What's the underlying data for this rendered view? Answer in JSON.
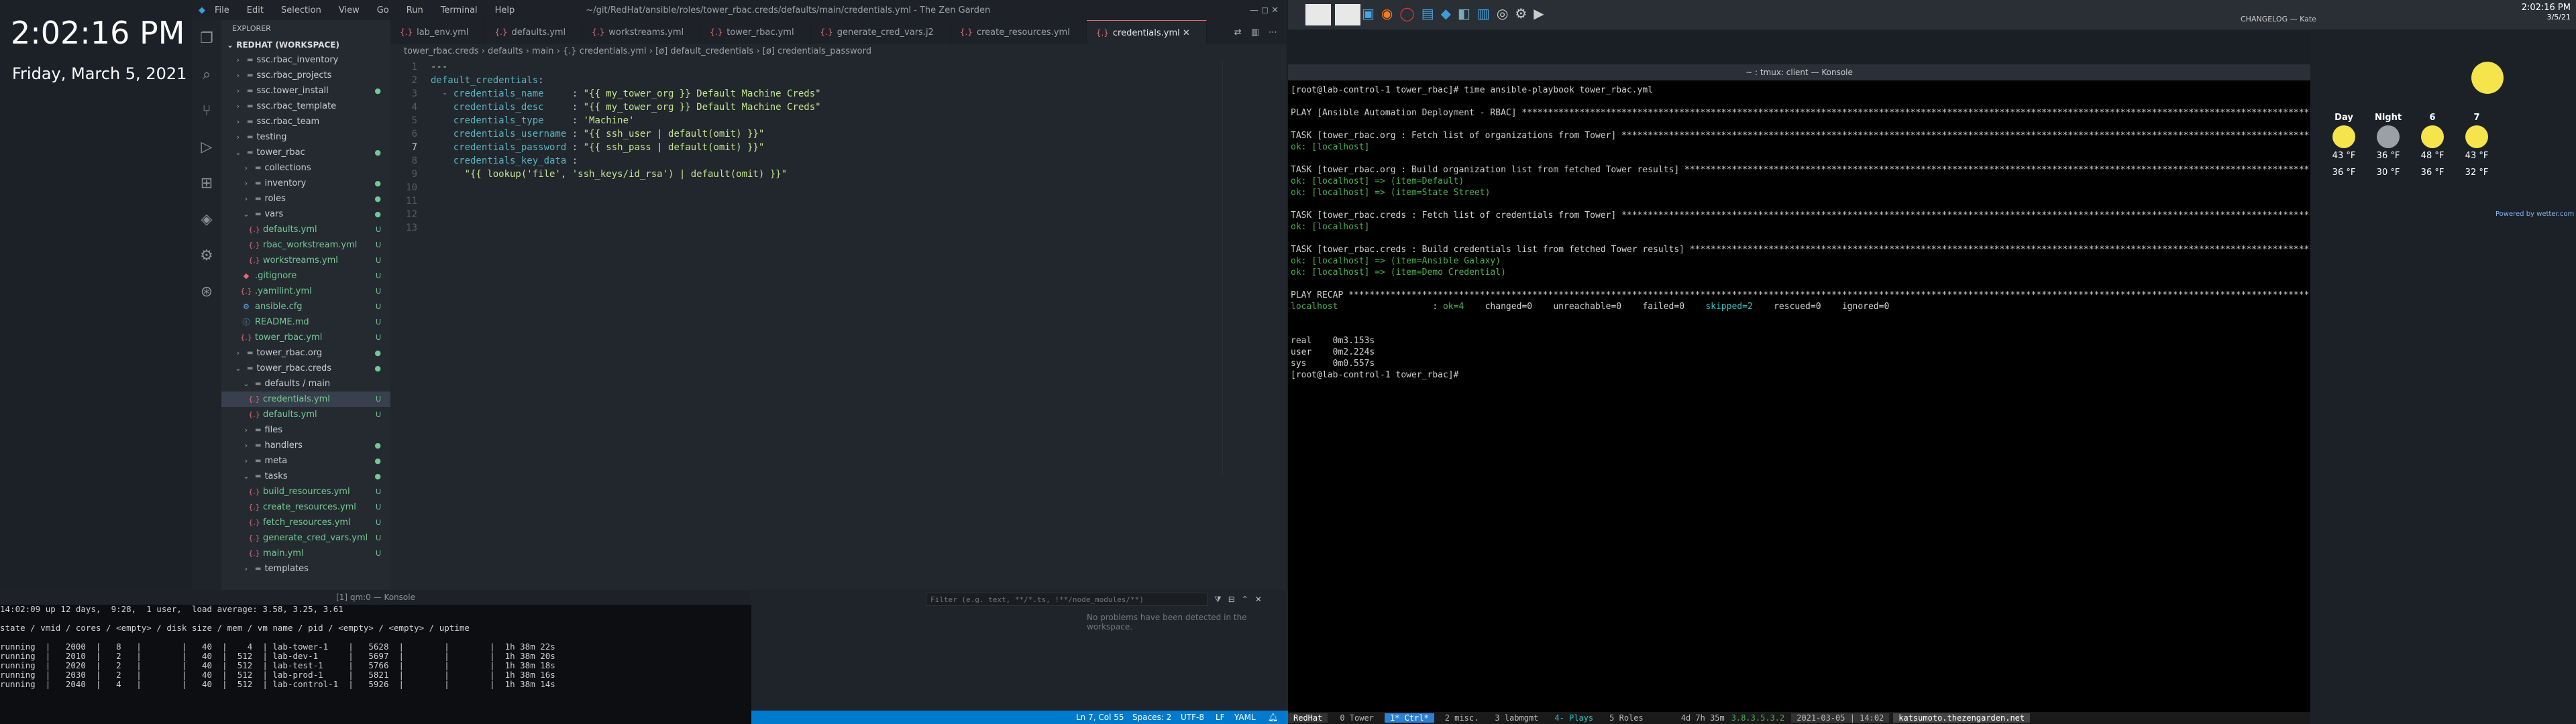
{
  "desktop": {
    "clock": "2:02:16 PM",
    "date": "Friday, March 5, 2021"
  },
  "vscode": {
    "title": "~/git/RedHat/ansible/roles/tower_rbac.creds/defaults/main/credentials.yml - The Zen Garden",
    "menu": [
      "File",
      "Edit",
      "Selection",
      "View",
      "Go",
      "Run",
      "Terminal",
      "Help"
    ],
    "explorer_title": "EXPLORER",
    "workspace": "REDHAT (WORKSPACE)",
    "explorer_items": [
      {
        "label": "ssc.rbac_inventory",
        "indent": 1,
        "kind": "folder",
        "status": ""
      },
      {
        "label": "ssc.rbac_projects",
        "indent": 1,
        "kind": "folder",
        "status": ""
      },
      {
        "label": "ssc.tower_install",
        "indent": 1,
        "kind": "folder",
        "status": "●"
      },
      {
        "label": "ssc.rbac_template",
        "indent": 1,
        "kind": "folder",
        "status": ""
      },
      {
        "label": "ssc.rbac_team",
        "indent": 1,
        "kind": "folder",
        "status": ""
      },
      {
        "label": "testing",
        "indent": 1,
        "kind": "folder",
        "status": ""
      },
      {
        "label": "tower_rbac",
        "indent": 1,
        "kind": "folder-open",
        "status": "●"
      },
      {
        "label": "collections",
        "indent": 2,
        "kind": "folder",
        "status": ""
      },
      {
        "label": "inventory",
        "indent": 2,
        "kind": "folder",
        "status": "●"
      },
      {
        "label": "roles",
        "indent": 2,
        "kind": "folder",
        "status": "●"
      },
      {
        "label": "vars",
        "indent": 2,
        "kind": "folder-open",
        "status": "●"
      },
      {
        "label": "defaults.yml",
        "indent": 3,
        "kind": "yml",
        "status": "U"
      },
      {
        "label": "rbac_workstream.yml",
        "indent": 3,
        "kind": "yml",
        "status": "U"
      },
      {
        "label": "workstreams.yml",
        "indent": 3,
        "kind": "yml",
        "status": "U"
      },
      {
        "label": ".gitignore",
        "indent": 2,
        "kind": "git",
        "status": "U"
      },
      {
        "label": ".yamllint.yml",
        "indent": 2,
        "kind": "yml",
        "status": "U"
      },
      {
        "label": "ansible.cfg",
        "indent": 2,
        "kind": "cfg",
        "status": "U"
      },
      {
        "label": "README.md",
        "indent": 2,
        "kind": "md",
        "status": "U"
      },
      {
        "label": "tower_rbac.yml",
        "indent": 2,
        "kind": "yml",
        "status": "U"
      },
      {
        "label": "tower_rbac.org",
        "indent": 1,
        "kind": "folder",
        "status": "●"
      },
      {
        "label": "tower_rbac.creds",
        "indent": 1,
        "kind": "folder-open",
        "status": "●"
      },
      {
        "label": "defaults / main",
        "indent": 2,
        "kind": "folder-open",
        "status": ""
      },
      {
        "label": "credentials.yml",
        "indent": 3,
        "kind": "yml",
        "status": "U"
      },
      {
        "label": "defaults.yml",
        "indent": 3,
        "kind": "yml",
        "status": "U"
      },
      {
        "label": "files",
        "indent": 2,
        "kind": "folder",
        "status": ""
      },
      {
        "label": "handlers",
        "indent": 2,
        "kind": "folder",
        "status": "●"
      },
      {
        "label": "meta",
        "indent": 2,
        "kind": "folder",
        "status": "●"
      },
      {
        "label": "tasks",
        "indent": 2,
        "kind": "folder-open",
        "status": "●"
      },
      {
        "label": "build_resources.yml",
        "indent": 3,
        "kind": "yml",
        "status": "U"
      },
      {
        "label": "create_resources.yml",
        "indent": 3,
        "kind": "yml",
        "status": "U"
      },
      {
        "label": "fetch_resources.yml",
        "indent": 3,
        "kind": "yml",
        "status": "U"
      },
      {
        "label": "generate_cred_vars.yml",
        "indent": 3,
        "kind": "yml",
        "status": "U"
      },
      {
        "label": "main.yml",
        "indent": 3,
        "kind": "yml",
        "status": "U"
      },
      {
        "label": "templates",
        "indent": 2,
        "kind": "folder",
        "status": ""
      }
    ],
    "tabs": [
      {
        "label": "lab_env.yml",
        "active": false
      },
      {
        "label": "defaults.yml",
        "active": false
      },
      {
        "label": "workstreams.yml",
        "active": false
      },
      {
        "label": "tower_rbac.yml",
        "active": false
      },
      {
        "label": "generate_cred_vars.j2",
        "active": false
      },
      {
        "label": "create_resources.yml",
        "active": false
      },
      {
        "label": "credentials.yml",
        "active": true
      }
    ],
    "breadcrumb": "tower_rbac.creds  ›  defaults  ›  main  ›  {.} credentials.yml  ›  [ø] default_credentials  ›  [ø] credentials_password",
    "code": [
      "---",
      "default_credentials:",
      "  - credentials_name     : \"{{ my_tower_org }} Default Machine Creds\"",
      "    credentials_desc     : \"{{ my_tower_org }} Default Machine Creds\"",
      "    credentials_type     : 'Machine'",
      "    credentials_username : \"{{ ssh_user | default(omit) }}\"",
      "    credentials_password : \"{{ ssh_pass | default(omit) }}\"",
      "    credentials_key_data :",
      "      \"{{ lookup('file', 'ssh_keys/id_rsa') | default(omit) }}\"",
      "",
      "",
      "",
      ""
    ],
    "current_line": 7,
    "problems_filter_placeholder": "Filter (e.g. text, **/*.ts, !**/node_modules/**)",
    "problems_msg": "No problems have been detected in the workspace.",
    "status": {
      "position": "Ln 7, Col 55",
      "spaces": "Spaces: 2",
      "encoding": "UTF-8",
      "eol": "LF",
      "lang": "YAML"
    }
  },
  "bottom_terminal": {
    "header": "[1] qm:0 — Konsole",
    "lines": [
      "14:02:09 up 12 days,  9:28,  1 user,  load average: 3.58, 3.25, 3.61",
      "",
      "state / vmid / cores / <empty> / disk size / mem / vm name / pid / <empty> / <empty> / uptime",
      "",
      "running  |   2000  |   8   |        |   40  |    4  | lab-tower-1    |   5628  |        |        |  1h 38m 22s",
      "running  |   2010  |   2   |        |   40  |  512  | lab-dev-1      |   5697  |        |        |  1h 38m 20s",
      "running  |   2020  |   2   |        |   40  |  512  | lab-test-1     |   5766  |        |        |  1h 38m 18s",
      "running  |   2030  |   2   |        |   40  |  512  | lab-prod-1     |   5821  |        |        |  1h 38m 16s",
      "running  |   2040  |   4   |        |   40  |  512  | lab-control-1  |   5926  |        |        |  1h 38m 14s"
    ]
  },
  "konsole": {
    "title": "~ : tmux: client — Konsole",
    "lines": [
      {
        "t": "[root@lab-control-1 tower_rbac]# time ansible-playbook tower_rbac.yml",
        "c": ""
      },
      {
        "t": "",
        "c": ""
      },
      {
        "t": "PLAY [Ansible Automation Deployment - RBAC] ************************************************************************************************************************************************************",
        "c": ""
      },
      {
        "t": "",
        "c": ""
      },
      {
        "t": "TASK [tower_rbac.org : Fetch list of organizations from Tower] *******************************************************************************************************************************************",
        "c": ""
      },
      {
        "t": "ok: [localhost]",
        "c": "g"
      },
      {
        "t": "",
        "c": ""
      },
      {
        "t": "TASK [tower_rbac.org : Build organization list from fetched Tower results] ***********************************************************************************************************************",
        "c": ""
      },
      {
        "t": "ok: [localhost] => (item=Default)",
        "c": "g"
      },
      {
        "t": "ok: [localhost] => (item=State Street)",
        "c": "g"
      },
      {
        "t": "",
        "c": ""
      },
      {
        "t": "TASK [tower_rbac.creds : Fetch list of credentials from Tower] *******************************************************************************************************************************************",
        "c": ""
      },
      {
        "t": "ok: [localhost]",
        "c": "g"
      },
      {
        "t": "",
        "c": ""
      },
      {
        "t": "TASK [tower_rbac.creds : Build credentials list from fetched Tower results] *****************************************************************************************************************************",
        "c": ""
      },
      {
        "t": "ok: [localhost] => (item=Ansible Galaxy)",
        "c": "g"
      },
      {
        "t": "ok: [localhost] => (item=Demo Credential)",
        "c": "g"
      },
      {
        "t": "",
        "c": ""
      },
      {
        "t": "PLAY RECAP ***********************************************************************************************************************************************************************************************",
        "c": ""
      },
      {
        "t": "localhost                  : ok=4    changed=0    unreachable=0    failed=0    skipped=2    rescued=0    ignored=0",
        "c": "recap"
      },
      {
        "t": "",
        "c": ""
      },
      {
        "t": "",
        "c": ""
      },
      {
        "t": "real    0m3.153s",
        "c": ""
      },
      {
        "t": "user    0m2.224s",
        "c": ""
      },
      {
        "t": "sys     0m0.557s",
        "c": ""
      },
      {
        "t": "[root@lab-control-1 tower_rbac]# ",
        "c": ""
      }
    ],
    "tmux_status": {
      "session": "RedHat",
      "windows": [
        "0  Tower",
        "1* Ctrl*",
        "2  misc.",
        "3  labmgmt",
        "4- Plays",
        "5  Roles"
      ],
      "uptime": "4d 7h 35m",
      "ip": "3.8.3.5.3.2",
      "datetime": "2021-03-05 | 14:02",
      "host": "katsumoto.thezengarden.net"
    }
  },
  "topbar": {
    "clock": "2:02:16 PM",
    "date": "3/5/21",
    "changelog": "CHANGELOG — Kate"
  },
  "weather": {
    "columns": [
      {
        "label": "Day",
        "hi": "43 °F",
        "lo": "36 °F",
        "icon": "sun-icon"
      },
      {
        "label": "Night",
        "hi": "36 °F",
        "lo": "30 °F",
        "icon": "moon-icon"
      },
      {
        "label": "6",
        "hi": "48 °F",
        "lo": "36 °F",
        "icon": "partly-cloudy-icon"
      },
      {
        "label": "7",
        "hi": "43 °F",
        "lo": "32 °F",
        "icon": "sun-icon"
      }
    ],
    "powered": "Powered by wetter.com"
  }
}
